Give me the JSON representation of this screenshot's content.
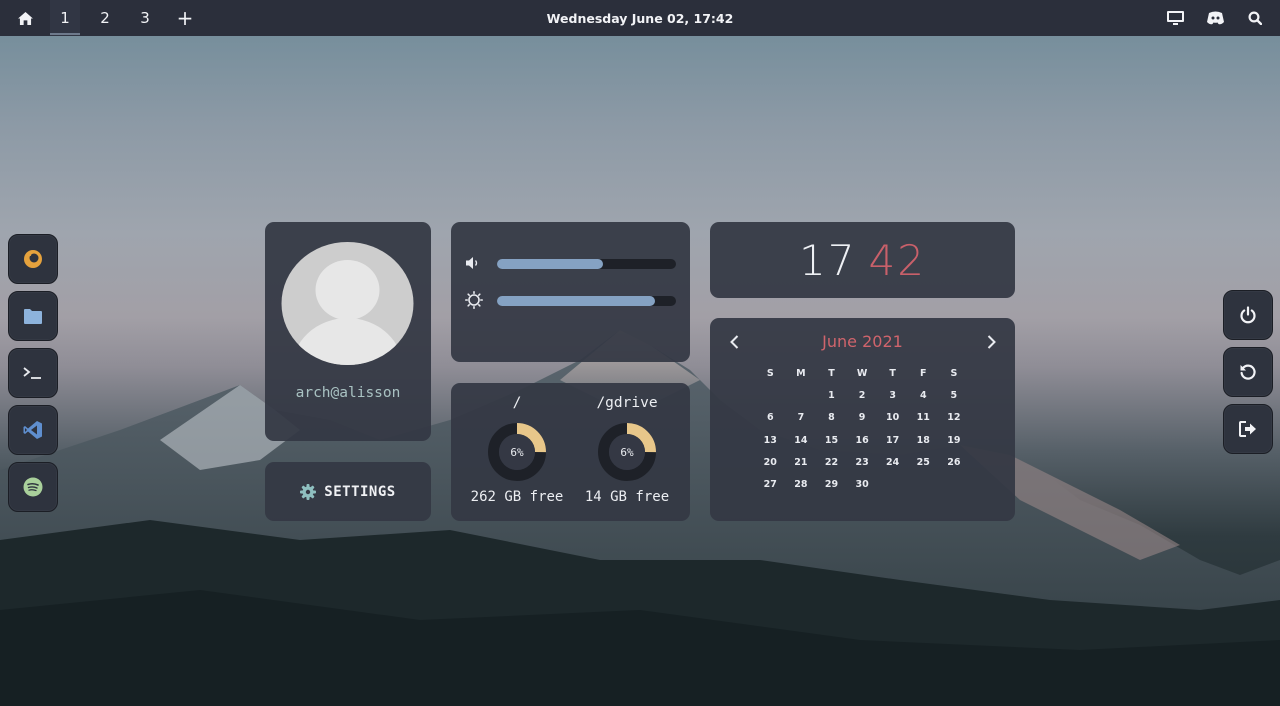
{
  "topbar": {
    "workspaces": [
      "1",
      "2",
      "3"
    ],
    "active_workspace": "1",
    "add_label": "+",
    "datetime": "Wednesday June 02, 17:42",
    "icons": [
      "home-icon",
      "monitor-icon",
      "discord-icon",
      "search-icon"
    ]
  },
  "left_dock": {
    "apps": [
      {
        "name": "firefox",
        "icon": "firefox-icon",
        "color": "#e5a23d"
      },
      {
        "name": "files",
        "icon": "folder-icon",
        "color": "#8db3dc"
      },
      {
        "name": "terminal",
        "icon": "terminal-icon",
        "color": "#e8eaee"
      },
      {
        "name": "vscode",
        "icon": "vscode-icon",
        "color": "#5f8fcf"
      },
      {
        "name": "spotify",
        "icon": "spotify-icon",
        "color": "#a9d09b"
      }
    ]
  },
  "right_dock": {
    "actions": [
      {
        "name": "power",
        "icon": "power-icon"
      },
      {
        "name": "restart",
        "icon": "restart-icon"
      },
      {
        "name": "logout",
        "icon": "logout-icon"
      }
    ]
  },
  "profile": {
    "username": "arch@alisson"
  },
  "settings": {
    "label": "SETTINGS"
  },
  "controls": {
    "volume": {
      "icon": "volume-icon",
      "level": 0.59
    },
    "brightness": {
      "icon": "brightness-icon",
      "level": 0.88
    }
  },
  "disks": [
    {
      "mount": "/",
      "percent": "6%",
      "fraction": 0.06,
      "free": "262 GB free"
    },
    {
      "mount": "/gdrive",
      "percent": "6%",
      "fraction": 0.06,
      "free": "14 GB free"
    }
  ],
  "clock": {
    "hours": "17",
    "minutes": "42"
  },
  "calendar": {
    "title": "June 2021",
    "weekdays": [
      "S",
      "M",
      "T",
      "W",
      "T",
      "F",
      "S"
    ],
    "weeks": [
      [
        "",
        "",
        "1",
        "2",
        "3",
        "4",
        "5"
      ],
      [
        "6",
        "7",
        "8",
        "9",
        "10",
        "11",
        "12"
      ],
      [
        "13",
        "14",
        "15",
        "16",
        "17",
        "18",
        "19"
      ],
      [
        "20",
        "21",
        "22",
        "23",
        "24",
        "25",
        "26"
      ],
      [
        "27",
        "28",
        "29",
        "30",
        "",
        "",
        ""
      ]
    ]
  },
  "colors": {
    "accent_red": "#c9606a",
    "slider_blue": "#85a2c3",
    "ring_yellow": "#e8c78a",
    "panel": "#343844"
  }
}
